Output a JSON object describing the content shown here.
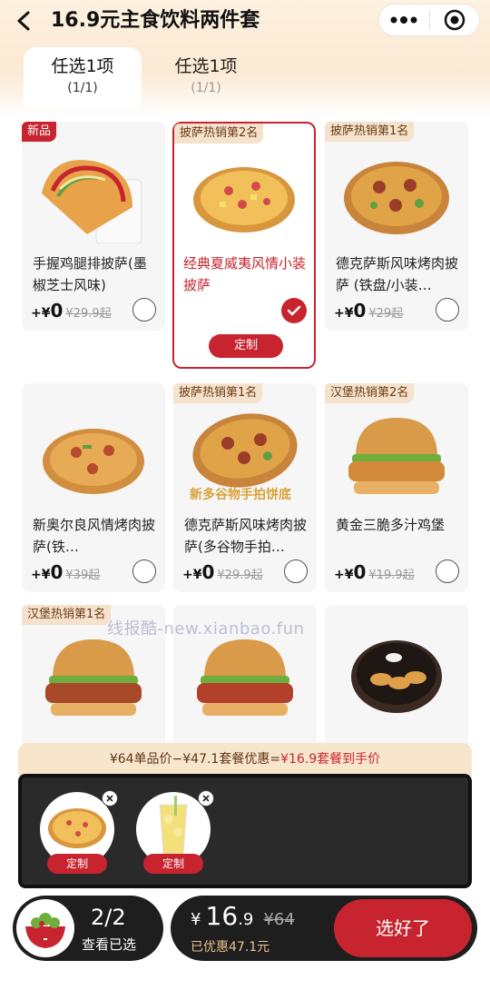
{
  "header": {
    "title": "16.9元主食饮料两件套"
  },
  "tabs": [
    {
      "name": "任选1项",
      "count": "(1/1)"
    },
    {
      "name": "任选1项",
      "count": "(1/1)"
    }
  ],
  "products": [
    {
      "badge": "新品",
      "name": "手握鸡腿排披萨(墨椒芝士风味)",
      "plus": "+¥",
      "price": "0",
      "orig": "¥29.9起"
    },
    {
      "badge": "披萨热销第2名",
      "name": "经典夏威夷风情小装披萨",
      "custom": "定制"
    },
    {
      "badge": "披萨热销第1名",
      "name": "德克萨斯风味烤肉披萨 (铁盘/小装…",
      "plus": "+¥",
      "price": "0",
      "orig": "¥29起"
    },
    {
      "badge": "",
      "name": "新奥尔良风情烤肉披萨(铁…",
      "plus": "+¥",
      "price": "0",
      "orig": "¥39起"
    },
    {
      "badge": "披萨热销第1名",
      "name": "德克萨斯风味烤肉披萨(多谷物手拍…",
      "img_caption": "新多谷物手拍饼底",
      "plus": "+¥",
      "price": "0",
      "orig": "¥29.9起"
    },
    {
      "badge": "汉堡热销第2名",
      "name": "黄金三脆多汁鸡堡",
      "plus": "+¥",
      "price": "0",
      "orig": "¥19.9起"
    },
    {
      "badge": "汉堡热销第1名"
    },
    {
      "badge": ""
    },
    {
      "badge": ""
    }
  ],
  "watermark": "线报酷-new.xianbao.fun",
  "promo": {
    "prefix": "¥64单品价−¥47.1套餐优惠=",
    "highlight": "¥16.9套餐到手价"
  },
  "tray": [
    {
      "button": "定制"
    },
    {
      "button": "定制"
    }
  ],
  "bottom": {
    "count": "2/2",
    "view_label": "查看已选",
    "yen": "¥",
    "price_int": "16",
    "price_dec": ".9",
    "was": "¥64",
    "saved": "已优惠47.1元",
    "confirm": "选好了"
  },
  "colors": {
    "accent": "#c8242f",
    "badge_bg": "#f4e2cc",
    "dark_bar": "#1e1e1e"
  },
  "icons": [
    "back-arrow-icon",
    "more-dots-icon",
    "target-icon",
    "check-icon",
    "close-icon",
    "salad-bowl-icon"
  ]
}
